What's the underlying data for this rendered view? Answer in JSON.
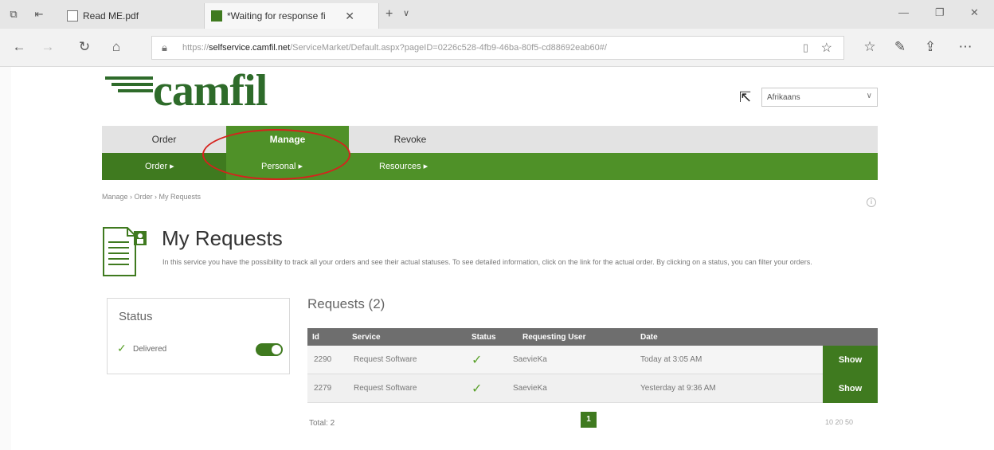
{
  "browser": {
    "tabs": [
      {
        "label": "Read ME.pdf"
      },
      {
        "label": "*Waiting for response fi"
      }
    ],
    "address": {
      "prefix": "https://",
      "host": "selfservice.camfil.net",
      "path": "/ServiceMarket/Default.aspx?pageID=0226c528-4fb9-46ba-80f5-cd88692eab60#/"
    }
  },
  "header": {
    "logo_text": "camfil",
    "language": "Afrikaans"
  },
  "top_menu": [
    {
      "label": "Order"
    },
    {
      "label": "Manage"
    },
    {
      "label": "Revoke"
    }
  ],
  "sub_menu": [
    {
      "label": "Order ▸"
    },
    {
      "label": "Personal ▸"
    },
    {
      "label": "Resources ▸"
    }
  ],
  "breadcrumb": "Manage › Order › My Requests",
  "page": {
    "title": "My Requests",
    "description": "In this service you have the possibility to track all your orders and see their actual statuses. To see detailed information, click on the link for the actual order. By clicking on a status, you can filter your orders."
  },
  "status_filter": {
    "title": "Status",
    "items": [
      {
        "label": "Delivered",
        "enabled": true
      }
    ]
  },
  "requests": {
    "title": "Requests (2)",
    "columns": [
      "Id",
      "Service",
      "Status",
      "Requesting User",
      "Date"
    ],
    "rows": [
      {
        "id": "2290",
        "service": "Request Software",
        "status": "✓",
        "user": "SaevieKa",
        "date": "Today at 3:05 AM",
        "action": "Show"
      },
      {
        "id": "2279",
        "service": "Request Software",
        "status": "✓",
        "user": "SaevieKa",
        "date": "Yesterday at 9:36 AM",
        "action": "Show"
      }
    ],
    "total_label": "Total: 2",
    "current_page": "1",
    "page_sizes": "10  20  50"
  },
  "colors": {
    "brand_green": "#3f7a1f",
    "menu_green": "#4f9128",
    "highlight_circle": "#d6221d"
  }
}
